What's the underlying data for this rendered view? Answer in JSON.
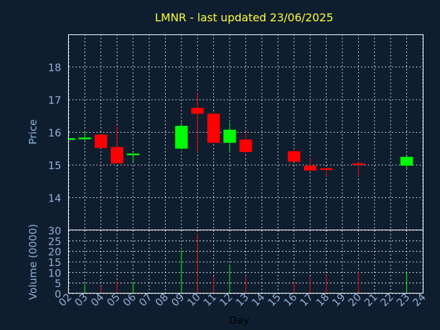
{
  "chart_data": [
    {
      "type": "candlestick",
      "title": "LMNR - last updated 23/06/2025",
      "ylabel": "Price",
      "ylim": [
        13,
        19
      ],
      "yticks": [
        14,
        15,
        16,
        17,
        18
      ],
      "grid": true,
      "candles": [
        {
          "day": "02",
          "open": 15.8,
          "high": 15.8,
          "low": 15.78,
          "close": 15.8
        },
        {
          "day": "03",
          "open": 15.78,
          "high": 16.05,
          "low": 15.75,
          "close": 15.82
        },
        {
          "day": "04",
          "open": 15.93,
          "high": 15.97,
          "low": 15.5,
          "close": 15.52
        },
        {
          "day": "05",
          "open": 15.55,
          "high": 16.2,
          "low": 15.05,
          "close": 15.05
        },
        {
          "day": "06",
          "open": 15.3,
          "high": 15.35,
          "low": 15.1,
          "close": 15.35
        },
        {
          "day": "09",
          "open": 15.5,
          "high": 16.3,
          "low": 15.5,
          "close": 16.2
        },
        {
          "day": "10",
          "open": 16.75,
          "high": 17.2,
          "low": 15.4,
          "close": 16.57
        },
        {
          "day": "11",
          "open": 16.57,
          "high": 16.6,
          "low": 15.66,
          "close": 15.68
        },
        {
          "day": "12",
          "open": 15.68,
          "high": 16.3,
          "low": 15.4,
          "close": 16.08
        },
        {
          "day": "13",
          "open": 15.78,
          "high": 16.0,
          "low": 15.3,
          "close": 15.4
        },
        {
          "day": "16",
          "open": 15.42,
          "high": 15.5,
          "low": 15.1,
          "close": 15.1
        },
        {
          "day": "17",
          "open": 14.98,
          "high": 15.2,
          "low": 14.8,
          "close": 14.83
        },
        {
          "day": "18",
          "open": 14.88,
          "high": 14.92,
          "low": 14.65,
          "close": 14.86
        },
        {
          "day": "20",
          "open": 15.05,
          "high": 15.1,
          "low": 14.65,
          "close": 15.0
        },
        {
          "day": "23",
          "open": 14.98,
          "high": 15.28,
          "low": 14.9,
          "close": 15.25
        }
      ]
    },
    {
      "type": "bar",
      "ylabel": "Volume (0000)",
      "xlabel": "Day",
      "ylim": [
        0,
        30
      ],
      "yticks": [
        0,
        5,
        10,
        15,
        20,
        25,
        30
      ],
      "grid": true,
      "categories": [
        "02",
        "03",
        "04",
        "05",
        "06",
        "07",
        "08",
        "09",
        "10",
        "11",
        "12",
        "13",
        "14",
        "15",
        "16",
        "17",
        "18",
        "19",
        "20",
        "21",
        "22",
        "23",
        "24"
      ],
      "volumes": [
        {
          "day": "03",
          "value": 4.5,
          "direction": "up"
        },
        {
          "day": "04",
          "value": 3.5,
          "direction": "down"
        },
        {
          "day": "05",
          "value": 5.5,
          "direction": "down"
        },
        {
          "day": "06",
          "value": 5.5,
          "direction": "up"
        },
        {
          "day": "09",
          "value": 20.5,
          "direction": "up"
        },
        {
          "day": "10",
          "value": 28.5,
          "direction": "down"
        },
        {
          "day": "11",
          "value": 8,
          "direction": "down"
        },
        {
          "day": "12",
          "value": 13.5,
          "direction": "up"
        },
        {
          "day": "13",
          "value": 8,
          "direction": "down"
        },
        {
          "day": "16",
          "value": 5.5,
          "direction": "down"
        },
        {
          "day": "17",
          "value": 8,
          "direction": "down"
        },
        {
          "day": "18",
          "value": 8.5,
          "direction": "down"
        },
        {
          "day": "20",
          "value": 10.5,
          "direction": "down"
        },
        {
          "day": "23",
          "value": 10.5,
          "direction": "up"
        }
      ]
    }
  ],
  "colors": {
    "background": "#0f1e2f",
    "frame": "#ffffff",
    "grid": "#ffffff",
    "up": "#00ff00",
    "down": "#ff0000",
    "title": "#ffff33",
    "axis_text": "#8fb0d8"
  }
}
